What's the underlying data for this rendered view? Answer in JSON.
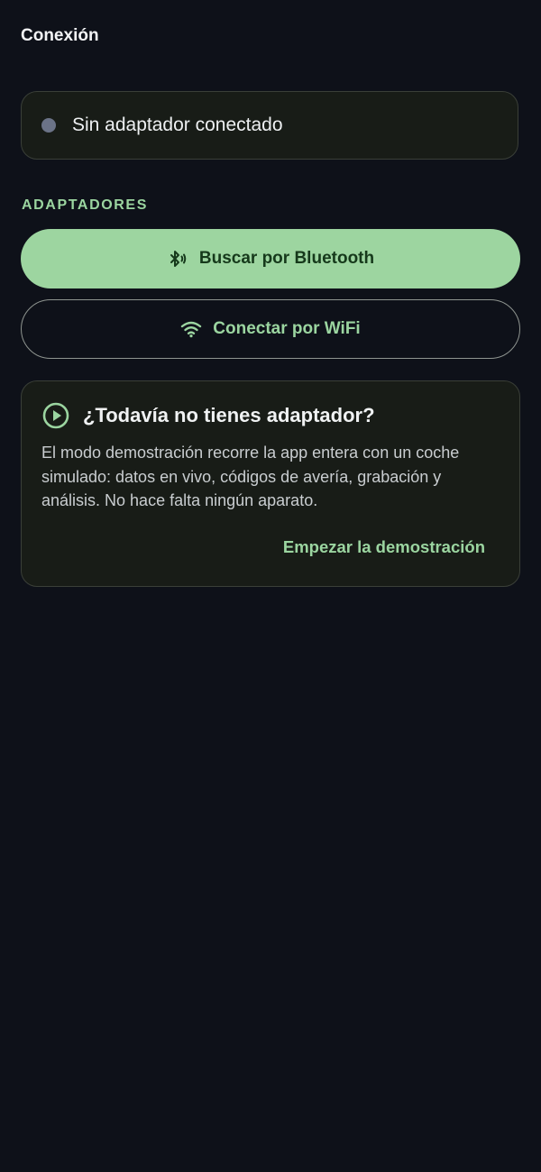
{
  "header": {
    "title": "Conexión"
  },
  "status": {
    "text": "Sin adaptador conectado",
    "dot_color": "#6b7387"
  },
  "adapters": {
    "section_label": "ADAPTADORES",
    "bluetooth_button": {
      "label": "Buscar por Bluetooth",
      "icon": "bluetooth-searching-icon"
    },
    "wifi_button": {
      "label": "Conectar por WiFi",
      "icon": "wifi-icon"
    }
  },
  "demo": {
    "icon": "play-circle-icon",
    "title": "¿Todavía no tienes adaptador?",
    "body": "El modo demostración recorre la app entera con un coche simulado: datos en vivo, códigos de avería, grabación y análisis. No hace falta ningún aparato.",
    "action_label": "Empezar la demostración"
  },
  "colors": {
    "background": "#0e1119",
    "accent": "#9dd5a0",
    "card": "#181c17"
  }
}
